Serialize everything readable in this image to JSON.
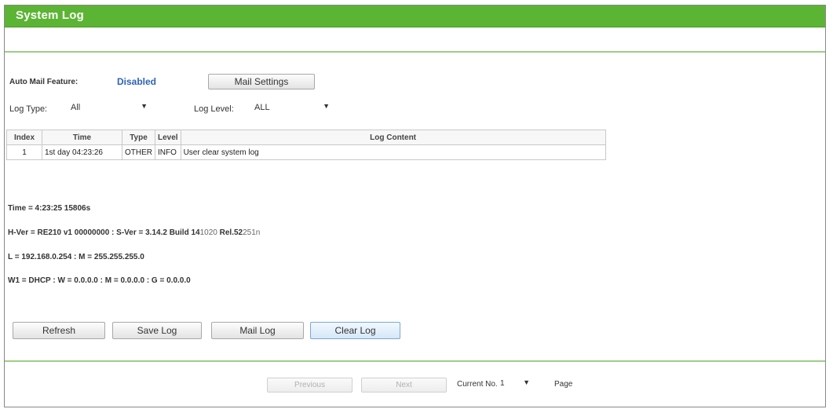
{
  "page": {
    "title": "System Log"
  },
  "mail": {
    "label": "Auto Mail Feature:",
    "status": "Disabled",
    "settings_button": "Mail Settings"
  },
  "filters": {
    "log_type_label": "Log Type:",
    "log_type_value": "All",
    "log_level_label": "Log Level:",
    "log_level_value": "ALL"
  },
  "table": {
    "headers": [
      "Index",
      "Time",
      "Type",
      "Level",
      "Log Content"
    ],
    "rows": [
      [
        "1",
        "1st day 04:23:26",
        "OTHER",
        "INFO",
        "User clear system log"
      ]
    ]
  },
  "info": {
    "time": "Time = 4:23:25 15806s",
    "hver_bold": "H-Ver = RE210 v1 00000000 : S-Ver = 3.14.2 Build 14",
    "hver_light": "1020",
    "hver_tail_bold": " Rel.52",
    "hver_tail_light": "251n",
    "lan": "L = 192.168.0.254 : M = 255.255.255.0",
    "wan": "W1 = DHCP : W = 0.0.0.0 : M = 0.0.0.0 : G = 0.0.0.0"
  },
  "actions": {
    "refresh": "Refresh",
    "save": "Save Log",
    "mail": "Mail Log",
    "clear": "Clear Log"
  },
  "pager": {
    "previous": "Previous",
    "next": "Next",
    "current_label": "Current No.",
    "current_value": "1",
    "page_label": "Page"
  }
}
